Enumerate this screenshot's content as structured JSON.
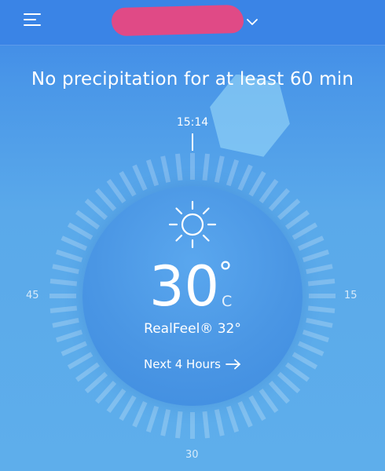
{
  "header": {
    "location_name": "",
    "menu_icon": "hamburger-menu-icon",
    "dropdown_icon": "chevron-down-icon"
  },
  "precipitation": {
    "message": "No precipitation for at least 60 min"
  },
  "dial": {
    "current_time": "15:14",
    "label_right": "15",
    "label_bottom": "30",
    "label_left": "45"
  },
  "current": {
    "icon": "sun-icon",
    "temperature": "30",
    "degree_symbol": "°",
    "unit": "C",
    "realfeel": "RealFeel® 32°",
    "next_hours_label": "Next 4 Hours"
  },
  "colors": {
    "header_bg": "#3a84e6",
    "background": "#5eaeeb",
    "redaction": "#e04a86"
  }
}
